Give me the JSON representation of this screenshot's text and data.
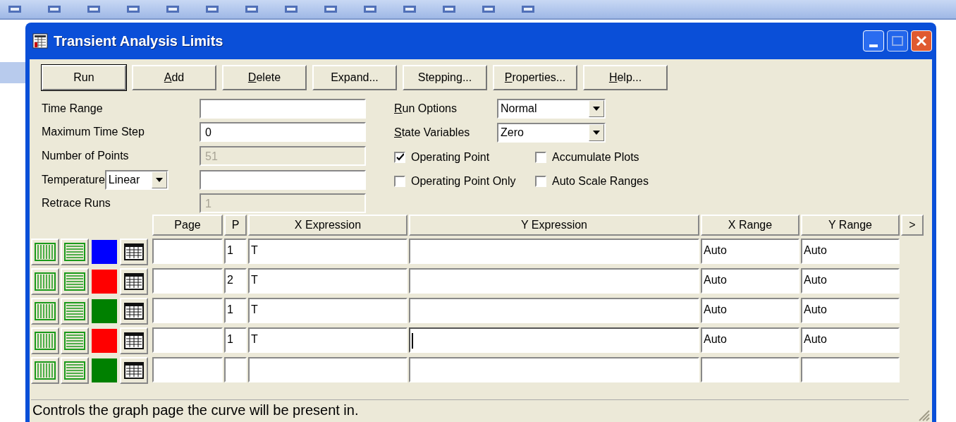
{
  "window": {
    "title": "Transient Analysis Limits"
  },
  "buttons": [
    {
      "label": "Run",
      "access_key": false,
      "default": true
    },
    {
      "label": "Add",
      "access_key": true,
      "default": false
    },
    {
      "label": "Delete",
      "access_key": true,
      "default": false
    },
    {
      "label": "Expand...",
      "access_key": false,
      "default": false
    },
    {
      "label": "Stepping...",
      "access_key": false,
      "default": false
    },
    {
      "label": "Properties...",
      "access_key": true,
      "default": false
    },
    {
      "label": "Help...",
      "access_key": true,
      "default": false
    }
  ],
  "fields": [
    {
      "kind": "text",
      "label": "Time Range",
      "disabled": false
    },
    {
      "kind": "text",
      "label": "Maximum Time Step",
      "value": "0",
      "disabled": false
    },
    {
      "kind": "text",
      "label": "Number of Points",
      "value": "51",
      "disabled": true
    },
    {
      "kind": "combo-text",
      "label": "Temperature",
      "combo": "Linear",
      "disabled": false
    },
    {
      "kind": "text",
      "label": "Retrace Runs",
      "value": "1",
      "disabled": true
    }
  ],
  "options": [
    {
      "label": "Run Options",
      "access_key": true,
      "value": "Normal"
    },
    {
      "label": "State Variables",
      "access_key": true,
      "value": "Zero"
    }
  ],
  "checkboxes": [
    {
      "label": "Operating Point",
      "checked": true
    },
    {
      "label": "Accumulate Plots",
      "checked": false
    },
    {
      "label": "Operating Point Only",
      "checked": false
    },
    {
      "label": "Auto Scale Ranges",
      "checked": false
    }
  ],
  "table": {
    "columns": [
      "Page",
      "P",
      "X Expression",
      "Y Expression",
      "X Range",
      "Y Range"
    ],
    "more_button": ">",
    "rows": [
      {
        "color": "#0000ff",
        "p": "1",
        "x_expression": "T",
        "x_range": "Auto",
        "y_range": "Auto",
        "focused": false
      },
      {
        "color": "#ff0000",
        "p": "2",
        "x_expression": "T",
        "x_range": "Auto",
        "y_range": "Auto",
        "focused": false
      },
      {
        "color": "#008000",
        "p": "1",
        "x_expression": "T",
        "x_range": "Auto",
        "y_range": "Auto",
        "focused": false
      },
      {
        "color": "#ff0000",
        "p": "1",
        "x_expression": "T",
        "x_range": "Auto",
        "y_range": "Auto",
        "focused": true
      },
      {
        "color": "#008000",
        "focused": false
      }
    ]
  },
  "status_bar": "Controls the graph page the curve will be present in."
}
